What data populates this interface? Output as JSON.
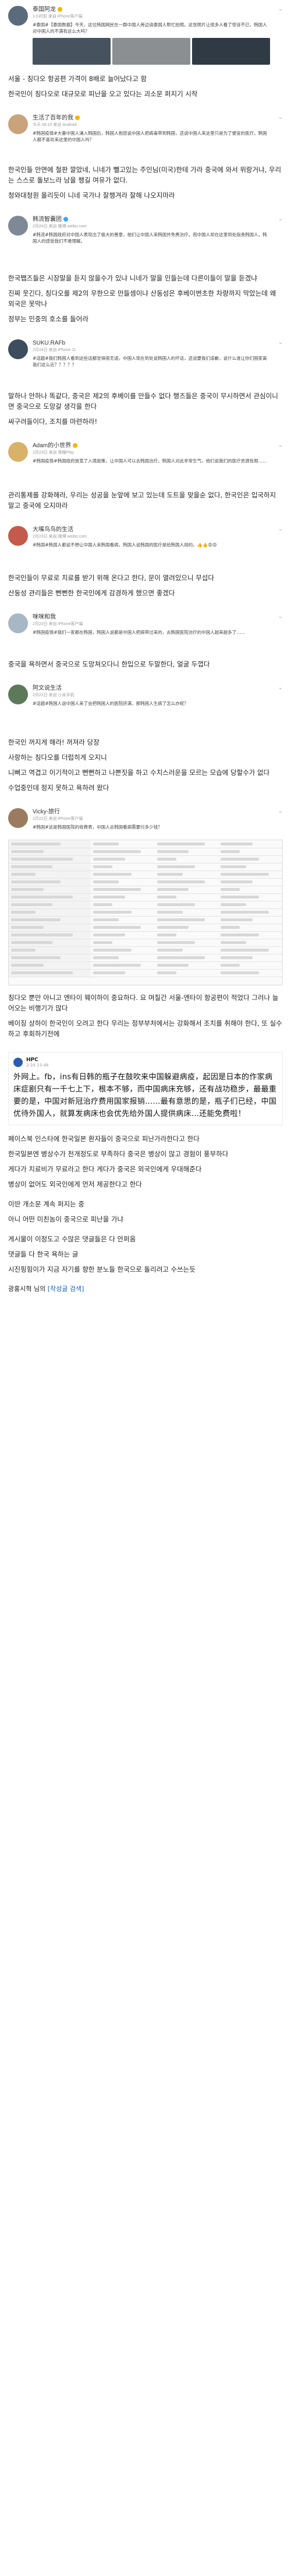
{
  "posts": [
    {
      "username": "泰国阿龙",
      "sub": "1小时前 来自 iPhone客户端",
      "snippet": "#泰国#【泰国数据】今天，这位韩国网民在一群中国人旁边请泰国人帮忙拍照。这张照片让很多人看了惊讶不已，韩国人对中国人的不满有这么大吗？",
      "tag": "#泰国#",
      "avatar_color": "#5a6b7c",
      "thumbs": [
        "#46535f",
        "#8c8f92",
        "#2f3a44",
        "#b8b3ad"
      ],
      "actions": [
        "转发",
        "评论",
        "赞"
      ]
    },
    {
      "username": "生活了百年的我",
      "sub": "今天 08:15 来自 Android",
      "snippet": "#韩国疫情#大量中国人涌入韩国后，韩国人抱怨说中国人把病毒带到韩国，还说中国人来这里只是为了便宜的医疗。韩国人都不喜欢来这里的中国人吗？",
      "tag": "#韩国疫情#",
      "avatar_color": "#c9a37a",
      "actions": [
        "转发",
        "评论",
        "赞"
      ]
    },
    {
      "username": "韩流智囊团",
      "sub": "2月24日 来自 微博 weibo.com",
      "snippet": "#韩流#韩国政府对中国人表现出了极大的善意，他们让中国人来韩国并免费治疗。而中国人却在这里到处指责韩国人，韩国人的感受我们不难理解。",
      "tag": "#韩流#",
      "avatar_color": "#7d8a96",
      "actions": [
        "转发",
        "评论",
        "赞"
      ]
    },
    {
      "username": "SUKU.RAFb",
      "sub": "2月24日 来自 iPhone 11",
      "snippet": "#话题#我们韩国人看到这些话都觉得很无语，中国人现在到处说韩国人的坏话，还说要我们道歉，说什么谁让你们国家离我们这么近？？？？？",
      "tag": "#话题#",
      "avatar_color": "#3d4c5e",
      "actions": [
        "转发",
        "评论",
        "赞"
      ]
    },
    {
      "username": "Adam的小世界",
      "sub": "2月23日 来自 荣耀Play",
      "snippet": "#韩国疫情#韩国政府放宽了入境政策，让中国人可以去韩国治疗。韩国人对此非常生气，他们说我们的医疗资源有限……",
      "tag": "#韩国疫情#",
      "avatar_color": "#d9b26a",
      "actions": [
        "转发",
        "评论",
        "赞"
      ]
    },
    {
      "username": "大嘴鸟鸟的生活",
      "sub": "2月23日 来自 微博 weibo.com",
      "snippet": "#韩国#韩国人都说不想让中国人来韩国看病，韩国人说韩国的医疗是给韩国人用的。👍👍😡😡",
      "tag": "#韩国#",
      "avatar_color": "#c25b4b",
      "actions": [
        "转发",
        "评论",
        "赞"
      ]
    },
    {
      "username": "咪咪和我",
      "sub": "2月23日 来自 iPhone客户端",
      "snippet": "#韩国疫情#我们一家都在韩国，韩国人说都是中国人把病带过来的，去韩国医院治疗的中国人越来越多了……",
      "tag": "#韩国疫情#",
      "avatar_color": "#a7b7c4",
      "actions": [
        "转发",
        "评论",
        "赞"
      ]
    },
    {
      "username": "阿文说生活",
      "sub": "2月22日 来自 小米手机",
      "snippet": "#话题#韩国人说中国人来了会把韩国人的医院挤满，那韩国人生病了怎么办呢？",
      "tag": "#话题#",
      "avatar_color": "#5c7a5a",
      "actions": [
        "转发",
        "评论",
        "赞"
      ]
    },
    {
      "username": "Vicky-旅行",
      "sub": "2月22日 来自 iPhone客户端",
      "snippet": "#韩国#这是韩国医院的收费表，中国人去韩国看病需要付多少钱？",
      "tag": "#韩国#",
      "avatar_color": "#9a7b5f",
      "actions": [
        "转发",
        "评论",
        "赞"
      ]
    }
  ],
  "blocks": {
    "b1": [
      "서울 - 칭다오 항공편 가격이 8배로 늘어났다고 함",
      "한국인이 칭다오로 대규모로 피난을 오고 있다는 괴소문 퍼지기 시작"
    ],
    "b2": [
      "한국인들 안면에 철판 깔았네, 니네가 뺄고있는 주인님(미국)한테 가라 중국에 와서 위랑거냐, 우리는 스스로 돌보느라 남을 챙길 여유가 없다.",
      "청와대청원 올리듯이 니네 국가나 잘챙겨라 잘해 나오지마라"
    ],
    "b3": [
      "한국쨉즈들은 시장말을 듣지 않을수가 있냐 니네가 말을 인들는데 다른이들이 말을 듣겠냐",
      "진짜 웃긴다, 칭다오를 제2의 우한으로 만들셈이냐 산동성은 후베이변초한 차량까지 막았는데 왜 외국은 못막나",
      "정부는 민중의 호소를 들어라"
    ],
    "b4": [
      "말하나 안하나 똑같다, 중국은 제2의 후베이를 만들수 없다 행즈들은 중국이 무시하면서 관심이니면 중국으로 도망갈 생각을 한다",
      "싸구려들이다, 조치를 마련하라!"
    ],
    "b5": [
      "관리통제를 강화해라, 우리는 성공을 눈앞에 보고 있는데 도트을 맞을순 없다, 한국인은 입국하지 말고 중국에 오지마라"
    ],
    "b6": [
      "한국인들이 무료로 치료를 받기 위해 온다고 한다, 문이 열려있으니 무섭다",
      "산둥성 관리들은 뻔뻔한 한국인에게 감경하게 했으면 좋겠다"
    ],
    "b7": [
      "중국을 욕하면서 중국으로 도망쳐오다니 한입으로 두말한다, 얼굴 두껍다"
    ],
    "b8": [
      "한국인 꺼지게 해라! 꺼져라 당장",
      "사랑하는 칭다오를 더럽히게 오지니",
      "니뻐고 역겹고 이기적이고 뻔뻔하고 나쁜짓을 하고 수치스러운을 모르는 모습에 당할수가 없다",
      "수업중인데 정지 못하고 욕하려 왔다"
    ],
    "b9": [
      "칭다오 뿐만 아니고 엔타이 웨이하이 중요하다. 요 며칠간 서울-엔타이 항공편이 적었다 그러나 늘어오는 비행기가 많다",
      "베이징 상하이 한국인이 오려고 한다 우리는 정부부처에서는 강화해서 조치를 취해야 한다, 또 실수하고 후회하기전에"
    ],
    "quote": {
      "name": "HPC",
      "time": "2-24 23:48",
      "text": "外网上。fb，ins有日韩的瓶子在鼓吹来中国躲避病疫，起因是日本的作家病床症剧只有一千七上下，根本不够，而中国病床充够，还有战功稳步，最最重要的是，中国对新冠治疗费用国家报销……最有意思的是，瓶子们已经，中国优待外国人，就算发病床也会优先给外国人提供病床…还能免费啦！"
    },
    "b10": [
      "페이스북 인스타에 한국일본 환자들이 중국으로 피난가라한다고 한다",
      "한국일본엔 병상수가 천개정도로 부족하다 중국은 병상이 많고 경험이 풍부하다",
      "게다가 치료비가 무료라고 한다 게다가 중국은 외국인에게 우대해준다",
      "병상이 없어도 외국인에게 먼저 제공한다고 한다"
    ],
    "b11": [
      "이딴 개소문 계속 퍼지는 중",
      "아니 어떤 미친놈이 중국으로 피난을 가냐"
    ],
    "b12": [
      "게시물이 이정도고 수많은 댓글들은 다 안퍼옴",
      "댓글들 다 한국 욕하는 글",
      "시진핑힘이가 지금 자기를 향한 분노들 한국으로 돌리려고 수쓰는듯"
    ],
    "footer": "광홍시혁 님의 ",
    "footer_link": "[작성글 검색]"
  }
}
